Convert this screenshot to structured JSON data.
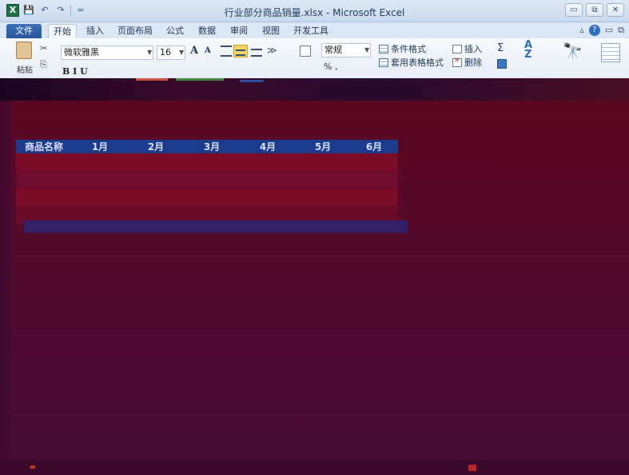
{
  "window": {
    "title": "行业部分商品销量.xlsx - Microsoft Excel",
    "app_badge": "X",
    "controls": {
      "minimize": "▭",
      "restore": "⧉",
      "close": "✕"
    }
  },
  "quick_access": {
    "save": "💾",
    "undo": "↶",
    "redo": "↷",
    "customize": "="
  },
  "ribbon_tabs": [
    {
      "label": "文件"
    },
    {
      "label": "开始"
    },
    {
      "label": "插入"
    },
    {
      "label": "页面布局"
    },
    {
      "label": "公式"
    },
    {
      "label": "数据"
    },
    {
      "label": "审阅"
    },
    {
      "label": "视图"
    },
    {
      "label": "开发工具"
    }
  ],
  "tab_right": {
    "minimize_ribbon": "▵",
    "help": "?",
    "restore_doc": "▭",
    "close_doc": "⧉"
  },
  "ribbon": {
    "paste_label": "粘贴",
    "cut_glyph": "✂",
    "copy_glyph": "⎘",
    "font_name": "微软雅黑",
    "font_size": "16",
    "grow_font": "A",
    "shrink_font": "A",
    "orientation_glyph": "≫",
    "number_format": "常规",
    "percent": "% ,",
    "conditional_format": "条件格式",
    "format_table": "套用表格格式",
    "insert": "插入",
    "delete": "删除",
    "sum_glyph": "Σ",
    "sort_glyph": "A",
    "sort_glyph2": "Z",
    "find_glyph": "🔭",
    "bold_row": "B  I  U"
  },
  "sheet_table": {
    "headers": [
      "商品名称",
      "1月",
      "2月",
      "3月",
      "4月",
      "5月",
      "6月"
    ]
  },
  "colors": {
    "header_fill": "#1b3b8c",
    "sheet_background": "#5c0a1e",
    "file_tab": "#2a5699"
  }
}
